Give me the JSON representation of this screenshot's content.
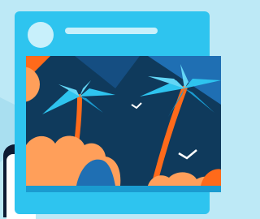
{
  "post": {
    "avatar_icon": "user-avatar-placeholder",
    "title_placeholder": "",
    "image_icon": "tropical-beach-illustration"
  },
  "colors": {
    "background": "#bde9f6",
    "card": "#2ec4ef",
    "placeholder": "#c8f0fb",
    "photo_sky": "#0f3a5c",
    "sand": "#ff9f5a",
    "accent": "#ff6a1a"
  }
}
